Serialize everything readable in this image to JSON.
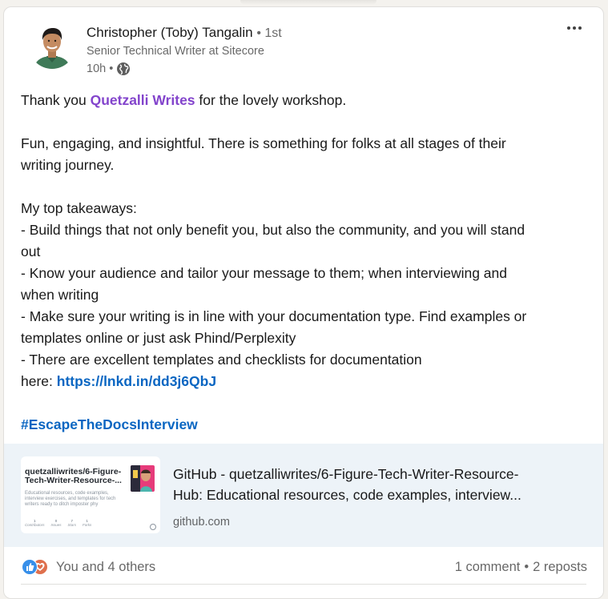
{
  "post": {
    "author": {
      "name": "Christopher (Toby) Tangalin",
      "degree": "1st",
      "headline": "Senior Technical Writer at Sitecore",
      "time": "10h",
      "visibility_icon": "globe-icon"
    },
    "more_icon": "more-horizontal-icon",
    "text": {
      "thanks_prefix": "Thank you ",
      "mention": "Quetzalli Writes",
      "thanks_suffix": " for the lovely workshop.",
      "para2_line1": "Fun, engaging, and insightful. There is something for folks at all stages of their",
      "para2_line2": "writing journey.",
      "takeaways_heading": "My top takeaways:",
      "t1_line1": "-  Build things that not only benefit you, but also the community, and you will stand",
      "t1_line2": "out",
      "t2_line1": "- Know your audience and tailor your message to them; when interviewing and",
      "t2_line2": "when writing",
      "t3_line1": "- Make sure your writing is in line with your documentation type. Find examples or",
      "t3_line2": "templates online or just ask Phind/Perplexity",
      "t4_line1": "- There are excellent templates and checklists for documentation",
      "t4_prefix": "here: ",
      "t4_link": "https://lnkd.in/dd3j6QbJ",
      "hashtag": "#EscapeTheDocsInterview"
    },
    "link_preview": {
      "thumbnail": {
        "title": "quetzalliwrites/6-Figure-Tech-Writer-Resource-...",
        "description": "Educational resources, code examples, interview exercises, and templates for tech writers ready to ditch imposter phy",
        "stats": [
          "Contributors",
          "Issues",
          "Stars",
          "Forks"
        ],
        "stat_values": [
          "1",
          "0",
          "7",
          "1"
        ]
      },
      "title_line1": "GitHub - quetzalliwrites/6-Figure-Tech-Writer-Resource-",
      "title_line2": "Hub: Educational resources, code examples, interview...",
      "domain": "github.com"
    },
    "social": {
      "reaction_icons": [
        "like-reaction-icon",
        "love-reaction-icon"
      ],
      "reactors": "You and 4 others",
      "comments": "1 comment",
      "separator": "•",
      "reposts": "2 reposts"
    }
  },
  "colors": {
    "mention": "#8344cc",
    "link": "#0a66c2",
    "preview_bg": "#edf3f8",
    "like": "#378fe9",
    "love": "#df704d"
  }
}
